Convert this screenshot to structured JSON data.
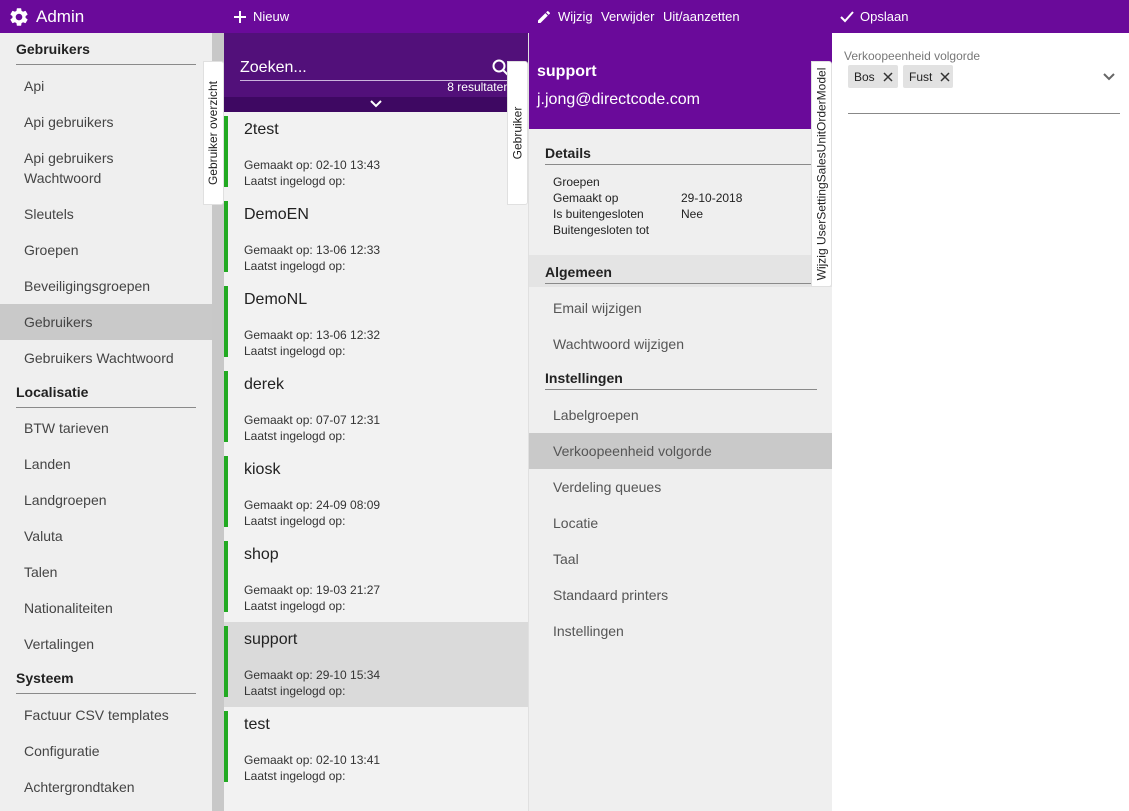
{
  "topbar": {
    "app_title": "Admin",
    "new_label": "Nieuw",
    "edit_label": "Wijzig",
    "delete_label": "Verwijder",
    "toggle_label": "Uit/aanzetten",
    "save_label": "Opslaan",
    "color": "#6a0a9a"
  },
  "sidebar": {
    "sections": [
      {
        "title": "Gebruikers",
        "items": [
          {
            "label": "Api"
          },
          {
            "label": "Api gebruikers"
          },
          {
            "label": "Api gebruikers Wachtwoord"
          },
          {
            "label": "Sleutels"
          },
          {
            "label": "Groepen"
          },
          {
            "label": "Beveiligingsgroepen"
          },
          {
            "label": "Gebruikers",
            "active": true
          },
          {
            "label": "Gebruikers Wachtwoord"
          }
        ]
      },
      {
        "title": "Localisatie",
        "items": [
          {
            "label": "BTW tarieven"
          },
          {
            "label": "Landen"
          },
          {
            "label": "Landgroepen"
          },
          {
            "label": "Valuta"
          },
          {
            "label": "Talen"
          },
          {
            "label": "Nationaliteiten"
          },
          {
            "label": "Vertalingen"
          }
        ]
      },
      {
        "title": "Systeem",
        "items": [
          {
            "label": "Factuur CSV templates"
          },
          {
            "label": "Configuratie"
          },
          {
            "label": "Achtergrondtaken"
          }
        ]
      }
    ]
  },
  "list": {
    "search_placeholder": "Zoeken...",
    "result_count": "8 resultaten",
    "tab_label": "Gebruiker overzicht",
    "users": [
      {
        "name": "2test",
        "created": "Gemaakt op: 02-10 13:43",
        "last_login": "Laatst ingelogd op:"
      },
      {
        "name": "DemoEN",
        "created": "Gemaakt op: 13-06 12:33",
        "last_login": "Laatst ingelogd op:"
      },
      {
        "name": "DemoNL",
        "created": "Gemaakt op: 13-06 12:32",
        "last_login": "Laatst ingelogd op:"
      },
      {
        "name": "derek",
        "created": "Gemaakt op: 07-07 12:31",
        "last_login": "Laatst ingelogd op:"
      },
      {
        "name": "kiosk",
        "created": "Gemaakt op: 24-09 08:09",
        "last_login": "Laatst ingelogd op:"
      },
      {
        "name": "shop",
        "created": "Gemaakt op: 19-03 21:27",
        "last_login": "Laatst ingelogd op:"
      },
      {
        "name": "support",
        "created": "Gemaakt op: 29-10 15:34",
        "last_login": "Laatst ingelogd op:",
        "active": true
      },
      {
        "name": "test",
        "created": "Gemaakt op: 02-10 13:41",
        "last_login": "Laatst ingelogd op:"
      }
    ]
  },
  "detail": {
    "tab_label": "Gebruiker",
    "name": "support",
    "email": "j.jong@directcode.com",
    "details_title": "Details",
    "fields": [
      {
        "key": "Groepen",
        "value": ""
      },
      {
        "key": "Gemaakt op",
        "value": "29-10-2018"
      },
      {
        "key": "Is buitengesloten",
        "value": "Nee"
      },
      {
        "key": "Buitengesloten tot",
        "value": ""
      }
    ],
    "general_title": "Algemeen",
    "general_items": [
      {
        "label": "Email wijzigen"
      },
      {
        "label": "Wachtwoord wijzigen"
      }
    ],
    "settings_title": "Instellingen",
    "settings_items": [
      {
        "label": "Labelgroepen"
      },
      {
        "label": "Verkoopeenheid volgorde",
        "active": true
      },
      {
        "label": "Verdeling queues"
      },
      {
        "label": "Locatie"
      },
      {
        "label": "Taal"
      },
      {
        "label": "Standaard printers"
      },
      {
        "label": "Instellingen"
      }
    ]
  },
  "edit": {
    "tab_label": "Wijzig UserSettingSalesUnitOrderModel",
    "field_label": "Verkoopeenheid volgorde",
    "chips": [
      {
        "label": "Bos"
      },
      {
        "label": "Fust"
      }
    ]
  },
  "colors": {
    "accent": "#6a0a9a",
    "search_bg": "#52107a",
    "status_active": "#22aa22"
  }
}
